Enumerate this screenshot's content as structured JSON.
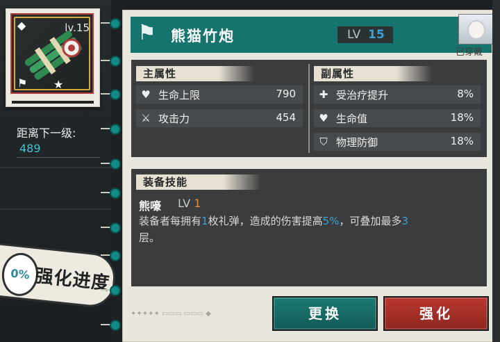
{
  "left": {
    "level_text": "lv.15",
    "next_level_label": "距离下一级:",
    "next_level_value": "489",
    "progress_percent": "0%",
    "progress_label": "强化进度"
  },
  "header": {
    "title": "熊猫竹炮",
    "lv_label": "LV",
    "lv_value": "15",
    "equipped_label": "已穿戴"
  },
  "main_stats": {
    "title": "主属性",
    "items": [
      {
        "icon": "heart-icon",
        "label": "生命上限",
        "value": "790"
      },
      {
        "icon": "swords-icon",
        "label": "攻击力",
        "value": "454"
      }
    ]
  },
  "sub_stats": {
    "title": "副属性",
    "items": [
      {
        "icon": "heal-icon",
        "label": "受治疗提升",
        "value": "8%"
      },
      {
        "icon": "heart-icon",
        "label": "生命值",
        "value": "18%"
      },
      {
        "icon": "shield-icon",
        "label": "物理防御",
        "value": "18%"
      }
    ]
  },
  "skill": {
    "title": "装备技能",
    "name": "熊嚎",
    "lv_label": "LV",
    "lv_value": "1",
    "desc_1": "装备者每拥有",
    "desc_hl_1": "1",
    "desc_2": "枚礼弹，造成的伤害提高",
    "desc_hl_2": "5%",
    "desc_3": "，可叠加最多",
    "desc_hl_3": "3",
    "desc_4": "层。"
  },
  "buttons": {
    "swap": "更换",
    "upgrade": "强化"
  },
  "colors": {
    "header_teal": "#16746f",
    "accent_blue": "#3aa0d6",
    "accent_orange": "#e48c38",
    "upgrade_red": "#b8382f"
  }
}
